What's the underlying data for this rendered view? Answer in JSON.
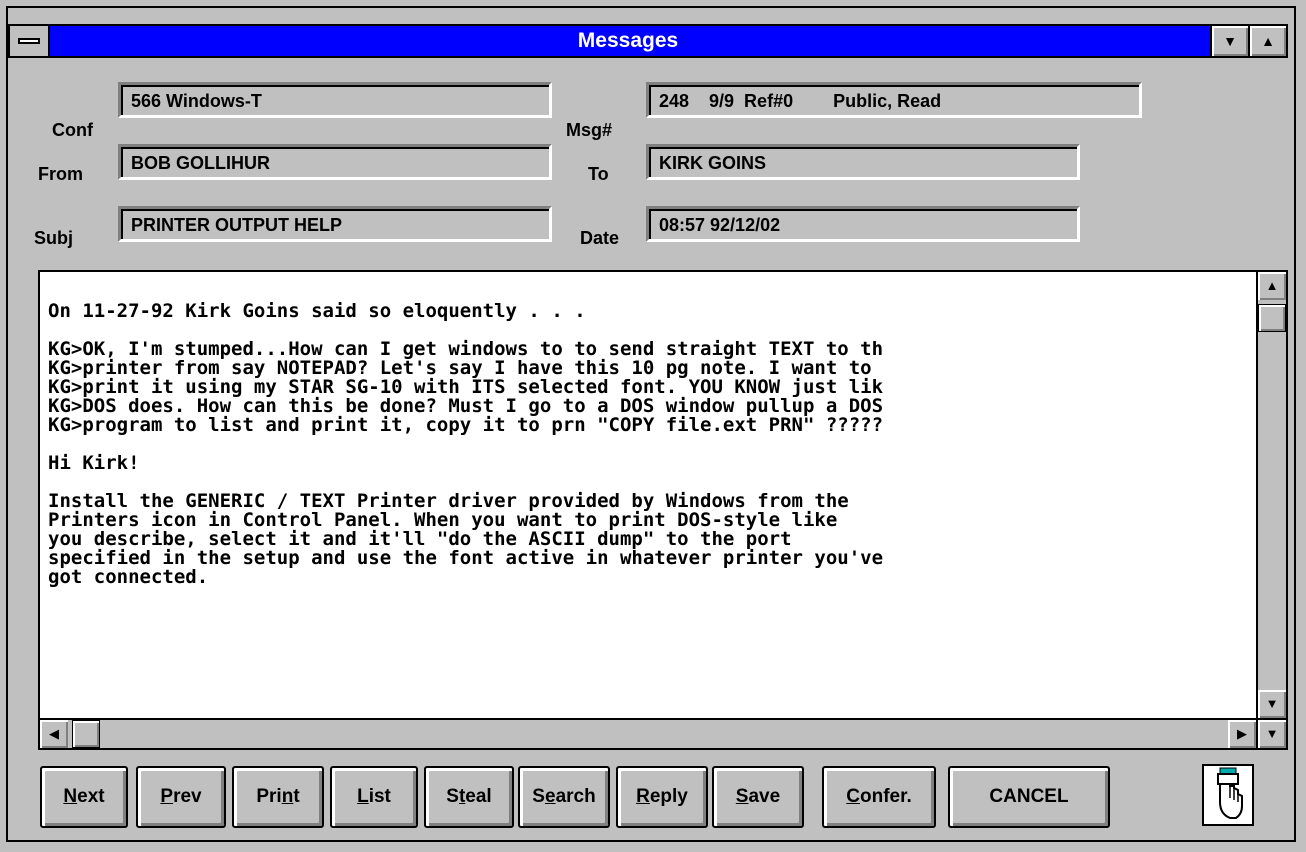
{
  "window": {
    "title": "Messages"
  },
  "header": {
    "conf_label": "Conf",
    "conf_value": "566 Windows-T",
    "msg_label": "Msg#",
    "msg_value": "248    9/9  Ref#0        Public, Read",
    "from_label": "From",
    "from_value": "BOB GOLLIHUR",
    "to_label": "To",
    "to_value": "KIRK GOINS",
    "subj_label": "Subj",
    "subj_value": "PRINTER OUTPUT HELP",
    "date_label": "Date",
    "date_value": "08:57 92/12/02"
  },
  "message": {
    "body": "On 11-27-92 Kirk Goins said so eloquently . . .\n\nKG>OK, I'm stumped...How can I get windows to to send straight TEXT to th\nKG>printer from say NOTEPAD? Let's say I have this 10 pg note. I want to\nKG>print it using my STAR SG-10 with ITS selected font. YOU KNOW just lik\nKG>DOS does. How can this be done? Must I go to a DOS window pullup a DOS\nKG>program to list and print it, copy it to prn \"COPY file.ext PRN\" ?????\n\nHi Kirk!\n\nInstall the GENERIC / TEXT Printer driver provided by Windows from the\nPrinters icon in Control Panel. When you want to print DOS-style like\nyou describe, select it and it'll \"do the ASCII dump\" to the port\nspecified in the setup and use the font active in whatever printer you've\ngot connected."
  },
  "buttons": {
    "next": {
      "u": "N",
      "rest": "ext"
    },
    "prev": {
      "u": "P",
      "rest": "rev"
    },
    "print": {
      "pre": "Pri",
      "u": "n",
      "rest": "t"
    },
    "list": {
      "u": "L",
      "rest": "ist"
    },
    "steal": {
      "pre": "S",
      "u": "t",
      "rest": "eal"
    },
    "search": {
      "pre": "S",
      "u": "e",
      "rest": "arch"
    },
    "reply": {
      "u": "R",
      "rest": "eply"
    },
    "save": {
      "u": "S",
      "rest": "ave"
    },
    "confer": {
      "u": "C",
      "rest": "onfer."
    },
    "cancel": "CANCEL"
  },
  "icons": {
    "sysmenu": "system-menu-icon",
    "minimize": "minimize-icon",
    "maximize": "maximize-icon",
    "hand": "pointing-hand-icon"
  },
  "colors": {
    "titlebar": "#0000ff",
    "face": "#c0c0c0"
  }
}
